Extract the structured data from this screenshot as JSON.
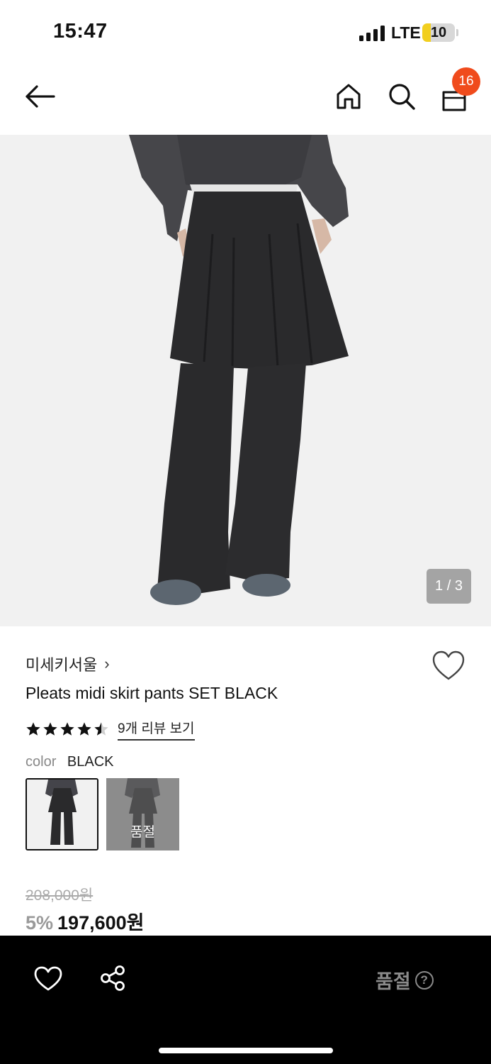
{
  "status_bar": {
    "time": "15:47",
    "network": "LTE",
    "battery_level": "10",
    "battery_fraction": 0.25
  },
  "nav": {
    "back_icon": "arrow-left-icon",
    "home_icon": "home-icon",
    "search_icon": "search-icon",
    "cart_icon": "shopping-bag-icon",
    "cart_count": "16"
  },
  "gallery": {
    "counter": "1 / 3"
  },
  "product": {
    "brand": "미세키서울",
    "brand_chevron": "›",
    "title": "Pleats midi skirt pants SET BLACK",
    "rating": 4.5,
    "rating_max": 5,
    "review_link": "9개 리뷰 보기",
    "color_label": "color",
    "color_value": "BLACK",
    "swatches": [
      {
        "state": "selected"
      },
      {
        "state": "soldout",
        "overlay": "품절"
      }
    ],
    "original_price": "208,000원",
    "discount": "5%",
    "sale_price": "197,600원"
  },
  "bottom_bar": {
    "wishlist_icon": "heart-outline-icon",
    "share_icon": "share-icon",
    "status": "품절",
    "help_icon": "help-circle-icon",
    "help_glyph": "?"
  },
  "colors": {
    "badge": "#f04b1c",
    "battery": "#f2cf1f",
    "bottom_bar": "#000000",
    "muted": "#8a8a8a"
  }
}
